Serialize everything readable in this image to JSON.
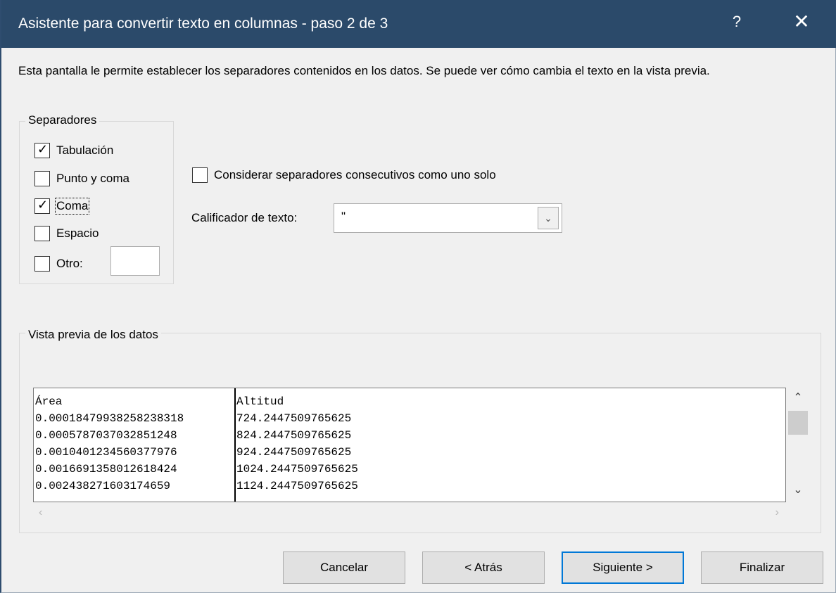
{
  "window": {
    "title": "Asistente para convertir texto en columnas - paso 2 de 3",
    "help_glyph": "?",
    "close_glyph": "✕"
  },
  "description": "Esta pantalla le permite establecer los separadores contenidos en los datos. Se puede ver cómo cambia el texto en la vista previa.",
  "separators": {
    "group_title": "Separadores",
    "tab": {
      "label": "Tabulación",
      "checked": true
    },
    "semicolon": {
      "label": "Punto y coma",
      "checked": false
    },
    "comma": {
      "label": "Coma",
      "checked": true
    },
    "space": {
      "label": "Espacio",
      "checked": false
    },
    "other": {
      "label": "Otro:",
      "checked": false,
      "value": ""
    }
  },
  "consecutive": {
    "label": "Considerar separadores consecutivos como uno solo",
    "checked": false
  },
  "qualifier": {
    "label": "Calificador de texto:",
    "value": "\""
  },
  "preview": {
    "group_title": "Vista previa de los datos",
    "rows": [
      [
        "Área",
        "Altitud"
      ],
      [
        "0.00018479938258238318",
        "724.2447509765625"
      ],
      [
        "0.0005787037032851248",
        "824.2447509765625"
      ],
      [
        "0.0010401234560377976",
        "924.2447509765625"
      ],
      [
        "0.0016691358012618424",
        "1024.2447509765625"
      ],
      [
        "0.002438271603174659",
        "1124.2447509765625"
      ]
    ]
  },
  "buttons": {
    "cancel": "Cancelar",
    "back": "< Atrás",
    "next": "Siguiente >",
    "finish": "Finalizar"
  },
  "icons": {
    "check": "✓",
    "dropdown": "chevron-down-icon",
    "scroll_up": "chevron-up-icon",
    "scroll_down": "chevron-down-icon",
    "scroll_left": "chevron-left-icon",
    "scroll_right": "chevron-right-icon"
  }
}
